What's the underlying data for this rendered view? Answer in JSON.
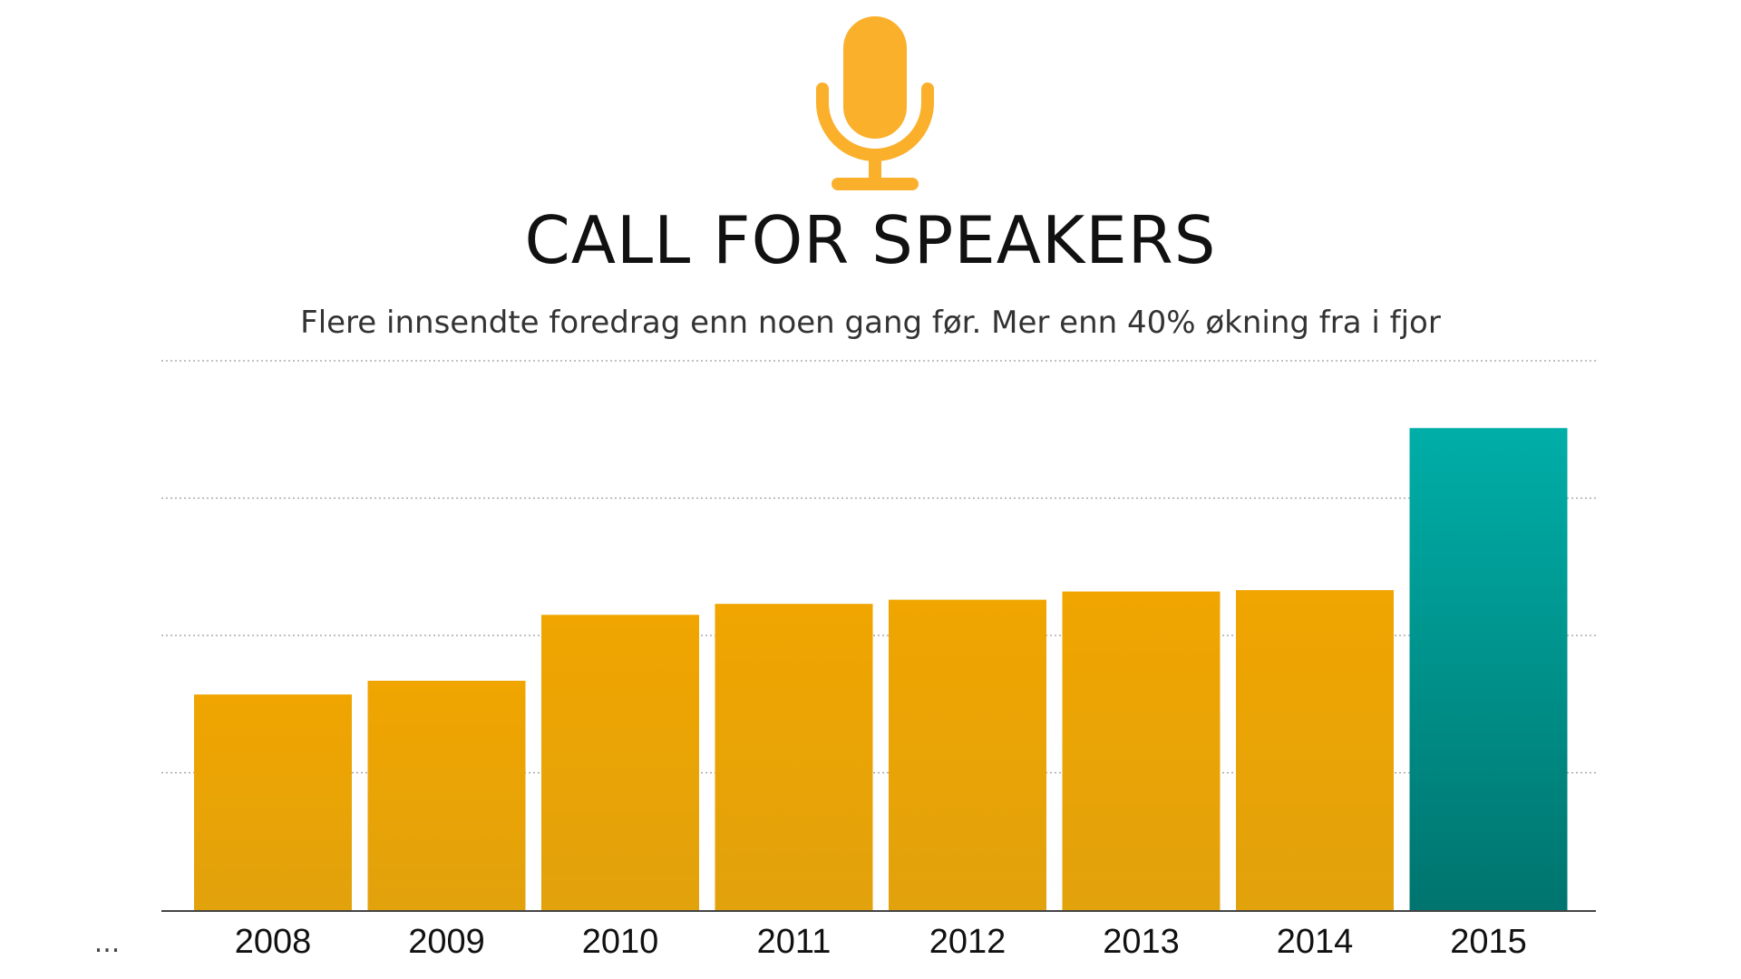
{
  "title": "CALL FOR SPEAKERS",
  "subtitle": "Flere innsendte foredrag enn noen gang før. Mer enn 40% økning fra i fjor",
  "mic_icon": "microphone-icon",
  "leading_ellipsis": "...",
  "colors": {
    "bar_gold_top": "#f0a500",
    "bar_gold_bottom": "#e2a20c",
    "bar_teal_top": "#00aea8",
    "bar_teal_bottom": "#00746e",
    "mic": "#fbb02c",
    "grid": "#9a9a9a",
    "axis": "#444444",
    "text": "#111111"
  },
  "chart_data": {
    "type": "bar",
    "title": "CALL FOR SPEAKERS",
    "subtitle": "Flere innsendte foredrag enn noen gang før. Mer enn 40% økning fra i fjor",
    "categories": [
      "2008",
      "2009",
      "2010",
      "2011",
      "2012",
      "2013",
      "2014",
      "2015"
    ],
    "values": [
      157,
      167,
      215,
      223,
      226,
      232,
      233,
      351
    ],
    "highlight_index": 7,
    "ylim": [
      0,
      400
    ],
    "y_gridlines": [
      100,
      200,
      300,
      400
    ],
    "grid": true,
    "y_tick_labels_visible": false,
    "xlabel": "",
    "ylabel": ""
  }
}
